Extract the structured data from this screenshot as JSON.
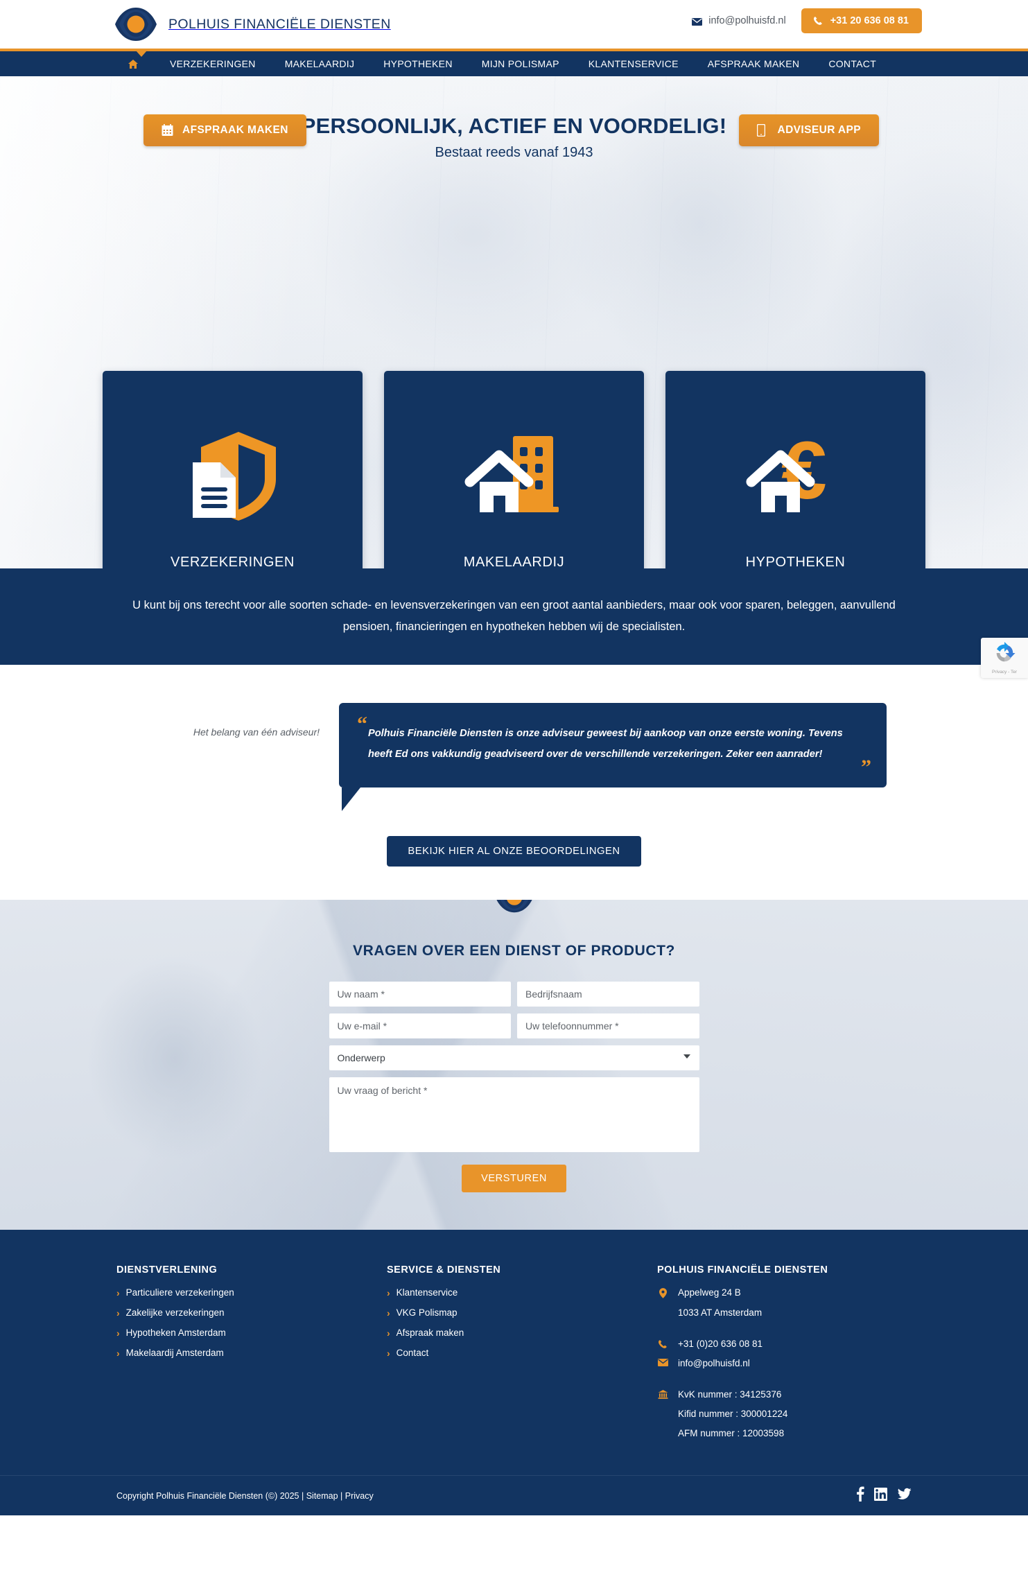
{
  "brand": {
    "name": "POLHUIS FINANCIËLE DIENSTEN",
    "logo_icon": "polhuis-eye-logo"
  },
  "topbar": {
    "email": "info@polhuisfd.nl",
    "email_icon": "envelope-icon",
    "phone": "+31 20 636 08 81",
    "phone_icon": "phone-icon"
  },
  "nav": {
    "home_icon": "home-icon",
    "items": [
      {
        "label": "VERZEKERINGEN"
      },
      {
        "label": "MAKELAARDIJ"
      },
      {
        "label": "HYPOTHEKEN"
      },
      {
        "label": "MIJN POLISMAP"
      },
      {
        "label": "KLANTENSERVICE"
      },
      {
        "label": "AFSPRAAK MAKEN"
      },
      {
        "label": "CONTACT"
      }
    ]
  },
  "hero": {
    "appointment_button": "AFSPRAAK MAKEN",
    "appointment_icon": "calendar-icon",
    "app_button": "ADVISEUR APP",
    "app_icon": "mobile-icon",
    "title": "PERSOONLIJK, ACTIEF EN VOORDELIG!",
    "subtitle": "Bestaat reeds vanaf 1943",
    "cards": [
      {
        "label": "VERZEKERINGEN",
        "icon": "shield-document-icon"
      },
      {
        "label": "MAKELAARDIJ",
        "icon": "house-building-icon"
      },
      {
        "label": "HYPOTHEKEN",
        "icon": "house-euro-icon"
      }
    ]
  },
  "intro": {
    "text": "U kunt bij ons terecht voor alle soorten schade- en levensverzekeringen van een groot aantal aanbieders, maar ook voor sparen, beleggen, aanvullend pensioen, financieringen en hypotheken hebben wij de specialisten."
  },
  "testimonial": {
    "side_note": "Het belang van één adviseur!",
    "quote_open": "“",
    "quote_close": "”",
    "quote": "Polhuis Financiële Diensten is onze adviseur geweest bij aankoop van onze eerste woning. Tevens heeft Ed ons vakkundig geadviseerd over de verschillende verzekeringen. Zeker een aanrader!",
    "reviews_button": "BEKIJK HIER AL ONZE BEOORDELINGEN"
  },
  "form": {
    "badge_icon": "polhuis-eye-logo",
    "title": "VRAGEN OVER EEN DIENST OF PRODUCT?",
    "name_placeholder": "Uw naam *",
    "company_placeholder": "Bedrijfsnaam",
    "email_placeholder": "Uw e-mail *",
    "phone_placeholder": "Uw telefoonnummer *",
    "subject_selected": "Onderwerp",
    "subject_icon": "chevron-down-icon",
    "message_placeholder": "Uw vraag of bericht *",
    "submit_label": "VERSTUREN"
  },
  "recaptcha": {
    "icon": "recaptcha-icon",
    "text": "Privacy - Ter"
  },
  "footer": {
    "col1": {
      "heading": "DIENSTVERLENING",
      "links": [
        {
          "label": "Particuliere verzekeringen"
        },
        {
          "label": "Zakelijke verzekeringen"
        },
        {
          "label": "Hypotheken Amsterdam"
        },
        {
          "label": "Makelaardij Amsterdam"
        }
      ]
    },
    "col2": {
      "heading": "SERVICE & DIENSTEN",
      "links": [
        {
          "label": "Klantenservice"
        },
        {
          "label": "VKG Polismap"
        },
        {
          "label": "Afspraak maken"
        },
        {
          "label": "Contact"
        }
      ]
    },
    "col3": {
      "heading": "POLHUIS FINANCIËLE DIENSTEN",
      "address_icon": "location-pin-icon",
      "address_line1": "Appelweg 24 B",
      "address_line2": "1033 AT Amsterdam",
      "phone_icon": "phone-icon",
      "phone": "+31 (0)20 636 08 81",
      "email_icon": "envelope-icon",
      "email": "info@polhuisfd.nl",
      "bank_icon": "bank-icon",
      "kvk": "KvK nummer : 34125376",
      "kifid": "Kifid nummer : 300001224",
      "afm": "AFM nummer : 12003598"
    }
  },
  "bottom": {
    "copyright": "Copyright Polhuis Financiële Diensten (©) 2025 | Sitemap | Privacy",
    "socials": [
      {
        "name": "facebook-icon"
      },
      {
        "name": "linkedin-icon"
      },
      {
        "name": "twitter-icon"
      }
    ]
  },
  "colors": {
    "navy": "#123461",
    "orange": "#e8942a",
    "white": "#ffffff"
  }
}
